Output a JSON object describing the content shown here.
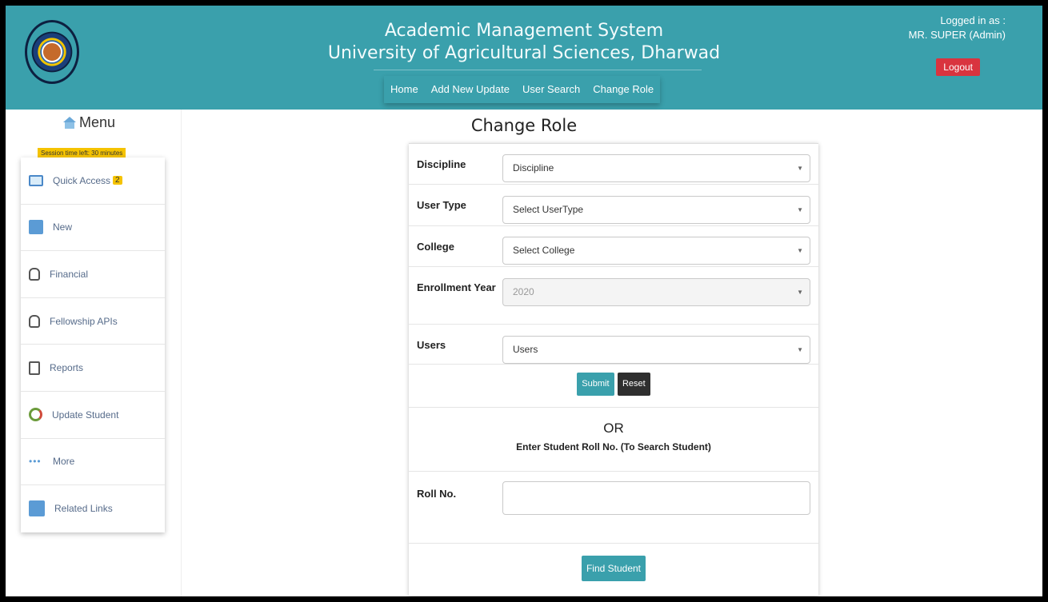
{
  "header": {
    "app_title": "Academic Management System",
    "university": "University of Agricultural Sciences, Dharwad",
    "nav": [
      "Home",
      "Add New Update",
      "User Search",
      "Change Role"
    ],
    "login_label": "Logged in as :",
    "login_user": "MR. SUPER (Admin)",
    "logout": "Logout",
    "accent_color": "#3aa0ac",
    "logout_color": "#d9343f"
  },
  "sidebar": {
    "menu_title": "Menu",
    "session": "Session time left: 30 minutes",
    "items": [
      {
        "label": "Quick Access",
        "icon": "laptop-icon",
        "badge": "2"
      },
      {
        "label": "New",
        "icon": "new-document-icon"
      },
      {
        "label": "Financial",
        "icon": "money-bag-icon"
      },
      {
        "label": "Fellowship APIs",
        "icon": "money-bag-icon"
      },
      {
        "label": "Reports",
        "icon": "report-icon"
      },
      {
        "label": "Update Student",
        "icon": "refresh-icon"
      },
      {
        "label": "More",
        "icon": "more-dots-icon"
      },
      {
        "label": "Related Links",
        "icon": "external-link-icon"
      }
    ]
  },
  "main": {
    "title": "Change Role",
    "fields": {
      "discipline": {
        "label": "Discipline",
        "value": "Discipline"
      },
      "user_type": {
        "label": "User Type",
        "value": "Select UserType"
      },
      "college": {
        "label": "College",
        "value": "Select College"
      },
      "enrollment_year": {
        "label": "Enrollment Year",
        "value": "2020"
      },
      "users": {
        "label": "Users",
        "value": "Users"
      }
    },
    "submit": "Submit",
    "reset": "Reset",
    "or_text": "OR",
    "or_sub": "Enter Student Roll No. (To Search Student)",
    "roll_label": "Roll No.",
    "roll_value": "",
    "find_student": "Find Student"
  }
}
